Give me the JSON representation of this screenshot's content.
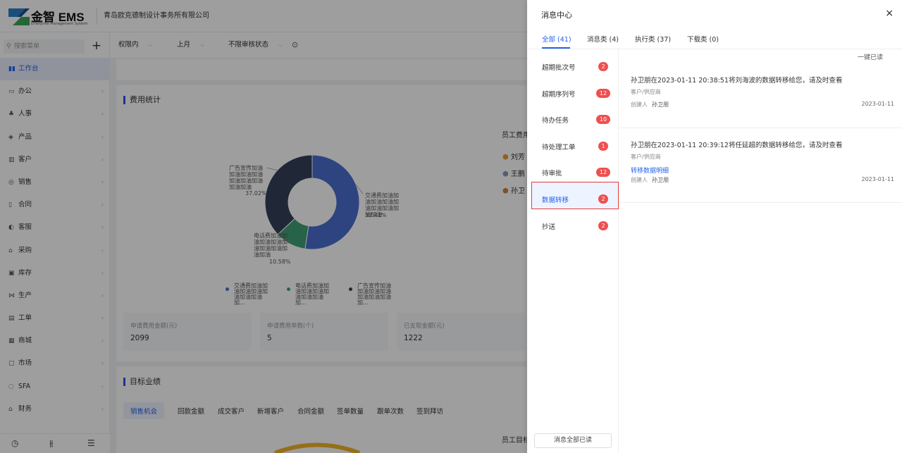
{
  "app": {
    "brand": "金智 EMS",
    "brand_sub": "Enterprise Management System",
    "company": "青岛欧克德制设计事务所有限公司"
  },
  "sidebar": {
    "search_placeholder": "搜索菜单",
    "add": "+",
    "items": [
      {
        "label": "工作台",
        "icon": "▮▮"
      },
      {
        "label": "办公",
        "icon": "▭"
      },
      {
        "label": "人事",
        "icon": "♣"
      },
      {
        "label": "产品",
        "icon": "◈"
      },
      {
        "label": "客户",
        "icon": "▥"
      },
      {
        "label": "销售",
        "icon": "◎"
      },
      {
        "label": "合同",
        "icon": "▯"
      },
      {
        "label": "客服",
        "icon": "◐"
      },
      {
        "label": "采购",
        "icon": "⌂"
      },
      {
        "label": "库存",
        "icon": "▣"
      },
      {
        "label": "生产",
        "icon": "⋈"
      },
      {
        "label": "工单",
        "icon": "▤"
      },
      {
        "label": "商城",
        "icon": "▦"
      },
      {
        "label": "市场",
        "icon": "▢"
      },
      {
        "label": "SFA",
        "icon": "◌"
      },
      {
        "label": "财务",
        "icon": "⌂"
      }
    ],
    "bottom_icons": [
      "clock-icon",
      "sliders-icon",
      "menu-icon"
    ]
  },
  "filters": {
    "scope": "权限内",
    "period": "上月",
    "audit": "不限审核状态"
  },
  "expense": {
    "title": "费用统计",
    "stats": [
      {
        "label": "申请费用金额(元)",
        "value": "2099"
      },
      {
        "label": "申请费用单数(个)",
        "value": "5"
      },
      {
        "label": "已支取金额(元)",
        "value": "1222"
      }
    ],
    "employee_title": "员工费用",
    "employees": [
      "刘芳",
      "王鹏",
      "孙卫"
    ]
  },
  "chart_data": {
    "type": "pie",
    "donut": true,
    "labels": [
      "交通费加油加油加油加油加油加油加油加油加油",
      "电话费加油加油加油加油加油加油加油加油加油",
      "广告宣传加油加油加油加油加油加油加油加油加油"
    ],
    "values": [
      52.41,
      10.58,
      37.02
    ],
    "value_labels": [
      "52.41%",
      "10.58%",
      "37.02%"
    ],
    "colors": [
      "#4b6fd0",
      "#3fa176",
      "#35415a"
    ],
    "legend": [
      "交通费加油加油加油加油加油加油加油加...",
      "电话费加油加油加油加油加油加油加油加...",
      "广告宣传加油加油加油加油加油加油加油加..."
    ]
  },
  "target": {
    "title": "目标业绩",
    "tabs": [
      "销售机会",
      "回款金额",
      "成交客户",
      "新增客户",
      "合同金额",
      "签单数量",
      "跟单次数",
      "签到拜访"
    ],
    "employee_title": "员工目标"
  },
  "panel": {
    "title": "消息中心",
    "close": "×",
    "tabs": [
      "全部 (41)",
      "消息类 (4)",
      "执行类 (37)",
      "下载类 (0)"
    ],
    "categories": [
      {
        "label": "超期批次号",
        "count": "2"
      },
      {
        "label": "超期序列号",
        "count": "12"
      },
      {
        "label": "待办任务",
        "count": "10"
      },
      {
        "label": "待处理工单",
        "count": "1"
      },
      {
        "label": "待审批",
        "count": "12"
      },
      {
        "label": "数据转移",
        "count": "2"
      },
      {
        "label": "抄送",
        "count": "2"
      }
    ],
    "mark_all_read_top": "一键已读",
    "mark_all_read_bottom": "消息全部已读",
    "messages": [
      {
        "text": "孙卫朋在2023-01-11 20:38:51将刘海波的数据转移给您，请及时查看",
        "sub": "客户/供应商",
        "link": "",
        "creator_label": "创建人",
        "creator": "孙卫朋",
        "date": "2023-01-11"
      },
      {
        "text": "孙卫朋在2023-01-11 20:39:12将任延超的数据转移给您，请及时查看",
        "sub": "客户/供应商",
        "link": "转移数据明细",
        "creator_label": "创建人",
        "creator": "孙卫朋",
        "date": "2023-01-11"
      }
    ]
  }
}
